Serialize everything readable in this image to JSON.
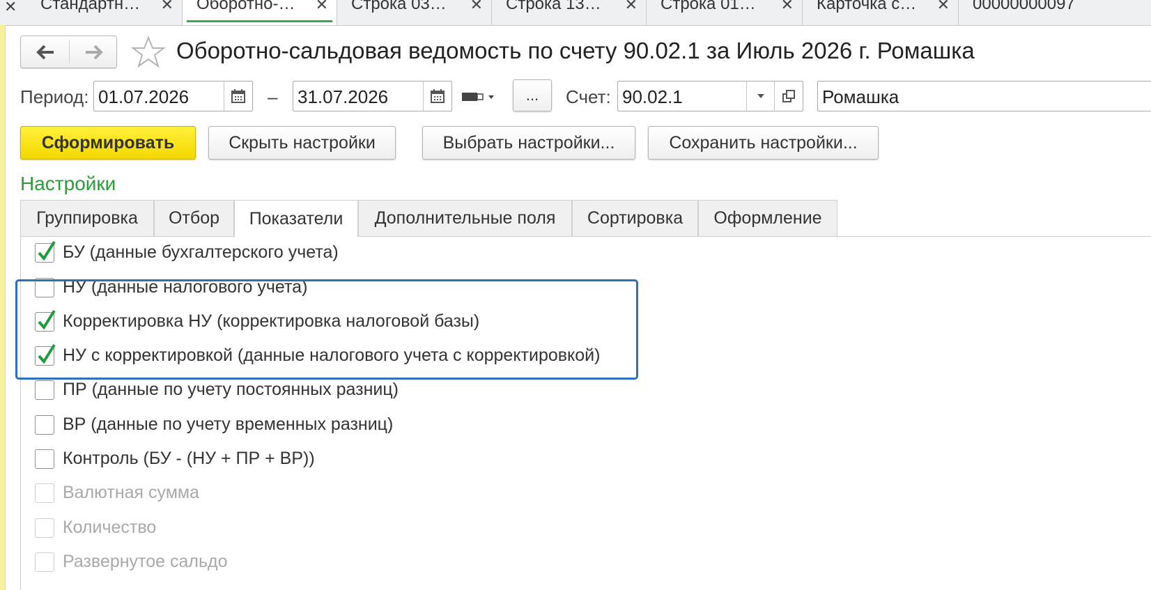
{
  "tabs": [
    {
      "label": "Стандартн…",
      "close": "✕"
    },
    {
      "label": "Оборотно-…",
      "close": "✕"
    },
    {
      "label": "Строка 03…",
      "close": "✕"
    },
    {
      "label": "Строка 13…",
      "close": "✕"
    },
    {
      "label": "Строка 01…",
      "close": "✕"
    },
    {
      "label": "Карточка с…",
      "close": "✕"
    },
    {
      "label": "00000000097",
      "close": ""
    }
  ],
  "left_close": "✕",
  "nav": {
    "back": "🡐",
    "forward": "🡒"
  },
  "title": "Оборотно-сальдовая ведомость по счету 90.02.1 за Июль 2026 г. Ромашка",
  "period": {
    "label": "Период:",
    "from": "01.07.2026",
    "dash": "–",
    "to": "31.07.2026",
    "more": "..."
  },
  "account": {
    "label": "Счет:",
    "value": "90.02.1"
  },
  "organization": {
    "value": "Ромашка"
  },
  "buttons": {
    "generate": "Сформировать",
    "hide_settings": "Скрыть настройки",
    "choose_settings": "Выбрать настройки...",
    "save_settings": "Сохранить настройки..."
  },
  "settings": {
    "title": "Настройки",
    "tabs": [
      "Группировка",
      "Отбор",
      "Показатели",
      "Дополнительные поля",
      "Сортировка",
      "Оформление"
    ],
    "active_tab": "Показатели"
  },
  "indicators": [
    {
      "label": "БУ (данные бухгалтерского учета)",
      "checked": true,
      "disabled": false
    },
    {
      "label": "НУ (данные налогового учета)",
      "checked": false,
      "disabled": false
    },
    {
      "label": "Корректировка НУ  (корректировка налоговой базы)",
      "checked": true,
      "disabled": false
    },
    {
      "label": "НУ с корректировкой (данные налогового учета с корректировкой)",
      "checked": true,
      "disabled": false
    },
    {
      "label": "ПР (данные по учету постоянных разниц)",
      "checked": false,
      "disabled": false
    },
    {
      "label": "ВР (данные по учету временных разниц)",
      "checked": false,
      "disabled": false
    },
    {
      "label": "Контроль (БУ - (НУ + ПР + ВР))",
      "checked": false,
      "disabled": false
    },
    {
      "label": "Валютная сумма",
      "checked": false,
      "disabled": true
    },
    {
      "label": "Количество",
      "checked": false,
      "disabled": true
    },
    {
      "label": "Развернутое сальдо",
      "checked": false,
      "disabled": true
    }
  ],
  "colors": {
    "accent_green": "#2c9b3a",
    "check_green": "#1f9d3a",
    "highlight_blue": "#2e6fb7",
    "primary_yellow": "#f3d800"
  }
}
